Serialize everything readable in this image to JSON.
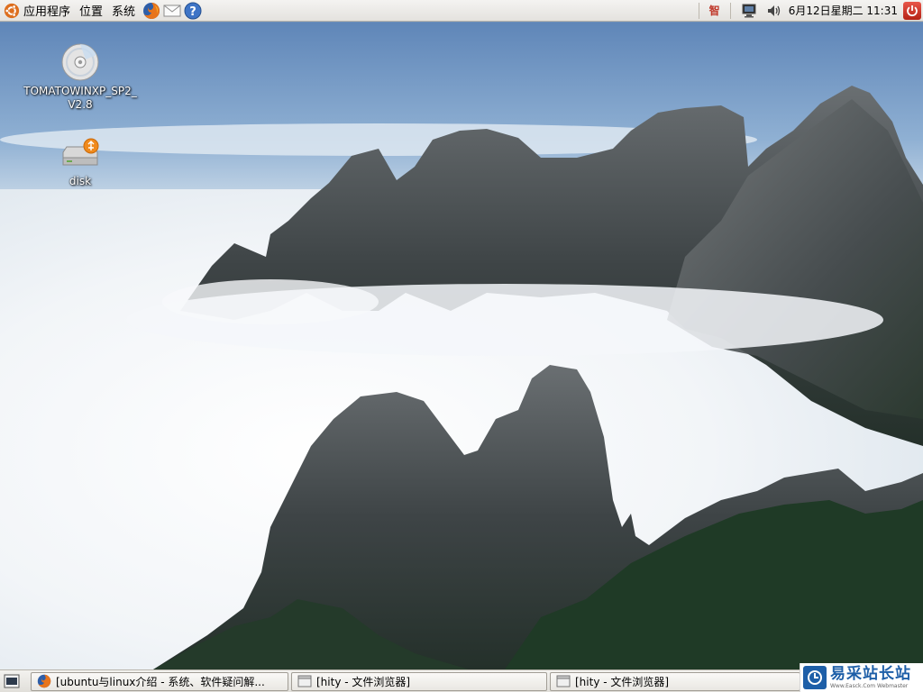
{
  "top_panel": {
    "menus": [
      "应用程序",
      "位置",
      "系统"
    ],
    "launchers": [
      "firefox-icon",
      "mail-icon",
      "help-icon"
    ],
    "tray": {
      "input_method": "智",
      "clock": "6月12日星期二 11:31"
    }
  },
  "desktop": {
    "icons": [
      {
        "label": "TOMATOWINXP_SP2_\nV2.8",
        "icon": "cd-icon"
      },
      {
        "label": "disk",
        "icon": "usb-drive-icon"
      }
    ]
  },
  "bottom_panel": {
    "tasks": [
      {
        "label": "[ubuntu与linux介绍 - 系统、软件疑问解...",
        "icon": "firefox-icon"
      },
      {
        "label": "[hity - 文件浏览器]",
        "icon": "folder-window-icon"
      },
      {
        "label": "[hity - 文件浏览器]",
        "icon": "folder-window-icon"
      }
    ]
  },
  "watermark": {
    "title": "易采站长站",
    "subtitle": "Www.Easck.Com Webmaster"
  },
  "colors": {
    "panel": "#ebe9e5",
    "sky": "#6d8fb8",
    "watermark_blue": "#1e5fa8",
    "shutdown_red": "#c8322a"
  }
}
